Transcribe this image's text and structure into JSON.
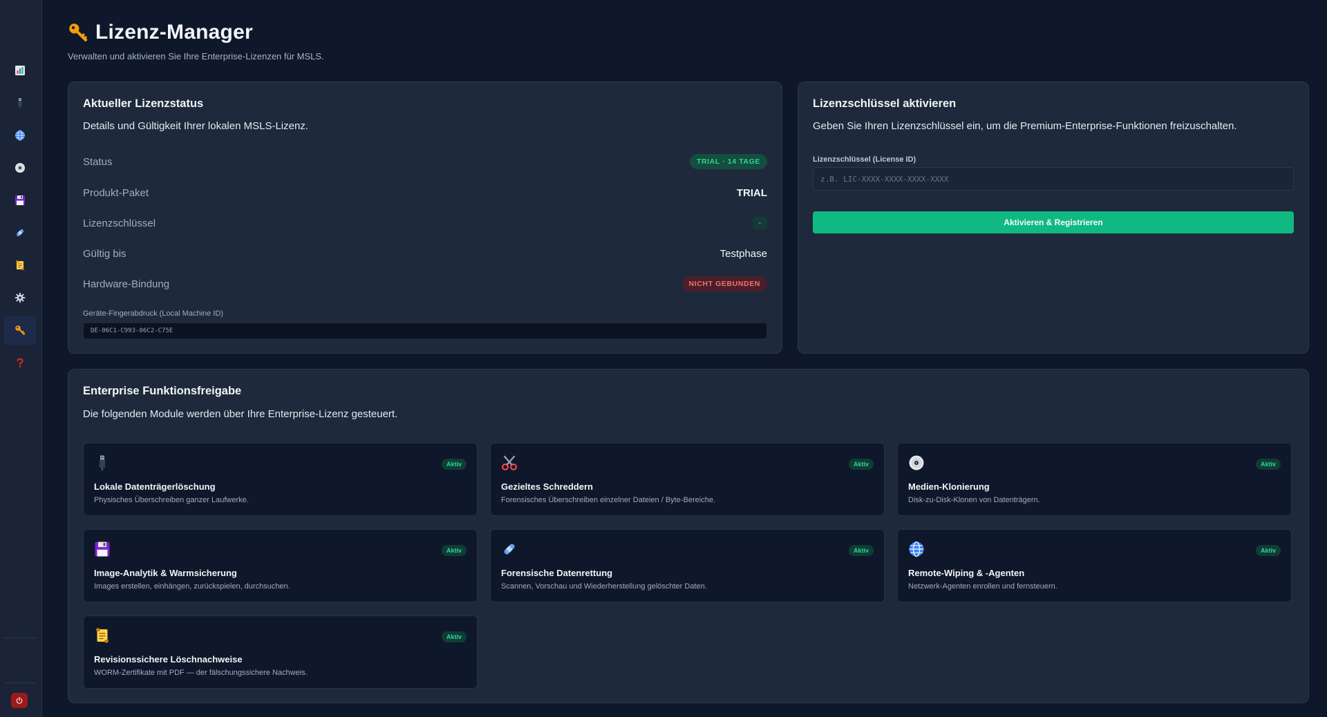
{
  "sidebar": {
    "items": [
      {
        "icon": "chart-icon",
        "active": false
      },
      {
        "icon": "usb-drive-icon",
        "active": false
      },
      {
        "icon": "globe-icon",
        "active": false
      },
      {
        "icon": "disc-icon",
        "active": false
      },
      {
        "icon": "floppy-disk-icon",
        "active": false
      },
      {
        "icon": "bandage-icon",
        "active": false
      },
      {
        "icon": "scroll-icon",
        "active": false
      },
      {
        "icon": "gear-icon",
        "active": false
      },
      {
        "icon": "key-icon",
        "active": true
      },
      {
        "icon": "question-mark-icon",
        "active": false
      }
    ],
    "power_icon": "power-icon"
  },
  "header": {
    "icon": "key-icon",
    "title": "Lizenz-Manager",
    "subtitle": "Verwalten und aktivieren Sie Ihre Enterprise-Lizenzen für MSLS."
  },
  "status_card": {
    "title": "Aktueller Lizenzstatus",
    "description": "Details und Gültigkeit Ihrer lokalen MSLS-Lizenz.",
    "rows": [
      {
        "label": "Status",
        "value": "TRIAL · 14 TAGE"
      },
      {
        "label": "Produkt-Paket",
        "value": "TRIAL"
      },
      {
        "label": "Lizenzschlüssel",
        "value": "-"
      },
      {
        "label": "Gültig bis",
        "value": "Testphase"
      },
      {
        "label": "Hardware-Bindung",
        "value": "NICHT GEBUNDEN"
      }
    ],
    "fingerprint_label": "Geräte-Fingerabdruck (Local Machine ID)",
    "fingerprint_value": "DE-06C1-C993-06C2-C75E"
  },
  "activate_card": {
    "title": "Lizenzschlüssel aktivieren",
    "description": "Geben Sie Ihren Lizenzschlüssel ein, um die Premium-Enterprise-Funktionen freizuschalten.",
    "input_label": "Lizenzschlüssel (License ID)",
    "input_value": "",
    "input_placeholder": "z.B. LIC-XXXX-XXXX-XXXX-XXXX",
    "button_label": "Aktivieren & Registrieren"
  },
  "features_card": {
    "title": "Enterprise Funktionsfreigabe",
    "description": "Die folgenden Module werden über Ihre Enterprise-Lizenz gesteuert.",
    "items": [
      {
        "icon": "usb-drive-icon",
        "name": "Lokale Datenträgerlöschung",
        "desc": "Physisches Überschreiben ganzer Laufwerke.",
        "status": "Aktiv"
      },
      {
        "icon": "scissors-icon",
        "name": "Gezieltes Schreddern",
        "desc": "Forensisches Überschreiben einzelner Dateien / Byte-Bereiche.",
        "status": "Aktiv"
      },
      {
        "icon": "disc-icon",
        "name": "Medien-Klonierung",
        "desc": "Disk-zu-Disk-Klonen von Datenträgern.",
        "status": "Aktiv"
      },
      {
        "icon": "floppy-disk-icon",
        "name": "Image-Analytik & Warmsicherung",
        "desc": "Images erstellen, einhängen, zurückspielen, durchsuchen.",
        "status": "Aktiv"
      },
      {
        "icon": "bandage-icon",
        "name": "Forensische Datenrettung",
        "desc": "Scannen, Vorschau und Wiederherstellung gelöschter Daten.",
        "status": "Aktiv"
      },
      {
        "icon": "globe-icon",
        "name": "Remote-Wiping & -Agenten",
        "desc": "Netzwerk-Agenten enrollen und fernsteuern.",
        "status": "Aktiv"
      },
      {
        "icon": "scroll-icon",
        "name": "Revisionssichere Löschnachweise",
        "desc": "WORM-Zertifikate mit PDF — der fälschungssichere Nachweis.",
        "status": "Aktiv"
      }
    ]
  },
  "colors": {
    "background": "#0f172a",
    "card": "#1e293b",
    "accent": "#10b981",
    "danger": "#f87171"
  }
}
